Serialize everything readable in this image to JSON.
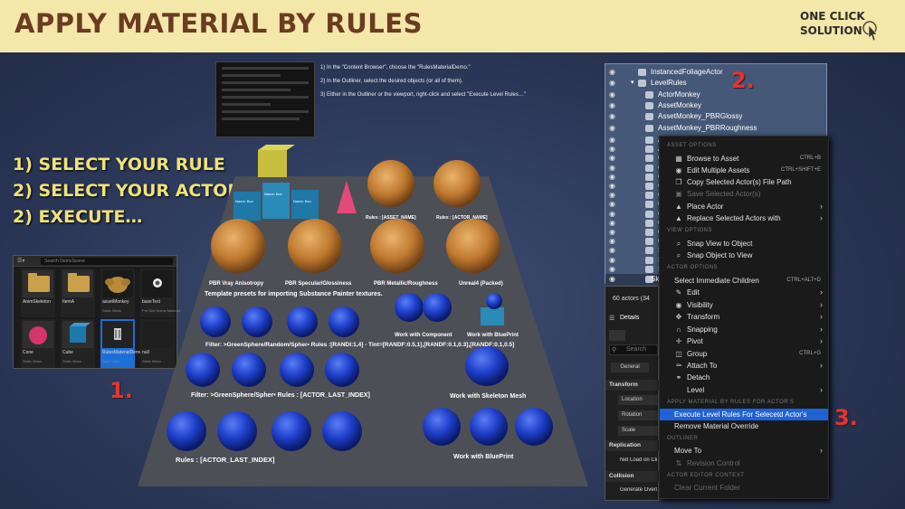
{
  "banner": {
    "title": "APPLY MATERIAL BY RULES",
    "one_click_line1": "ONE CLICK",
    "one_click_line2": "SOLUTION",
    "icon": "pointer-cursor-icon",
    "bg_color": "#f3e7a9",
    "title_color": "#6b3b23"
  },
  "steps": {
    "line1": "1) SELECT YOUR RULE",
    "line2": "2) SELECT YOUR ACTOR’S",
    "line3": "2) EXECUTE…",
    "color": "#f1e27a"
  },
  "markers": {
    "m1": "1.",
    "m2": "2.",
    "m3": "3.",
    "color": "#e8322f"
  },
  "instructions": [
    "1) In the \"Content Browser\", choose the \"RulesMaterialDemo.\"",
    "2) In the Outliner, select the desired objects (or all of them).",
    "3) Either in the Outliner or the viewport, right-click and select \"Execute Level Rules…\""
  ],
  "content_browser": {
    "search_placeholder": "Search DemoScene",
    "tiles": [
      {
        "name": "AnimSkeleton",
        "type": ""
      },
      {
        "name": "ItemA",
        "type": ""
      },
      {
        "name": "assetMonkey",
        "type": "Static Mesh"
      },
      {
        "name": "baseText",
        "type": "Pre Dist Scene Material"
      },
      {
        "name": "Cone",
        "type": "Static Mesh"
      },
      {
        "name": "Cube",
        "type": "Static Mesh"
      },
      {
        "name": "RulesMaterialDemo",
        "type": "Data Table"
      },
      {
        "name": "null",
        "type": "Static Mesh"
      }
    ]
  },
  "viewport": {
    "rules_asset_name": "Rules : [ASSET_NAME]",
    "rules_actor_name": "Rules : [ACTOR_NAME]",
    "pbr_labels": [
      "PBR Vray Anisotropy",
      "PBR Specular/Glossiness",
      "PBR Metallic/Roughness",
      "Unreal4 (Packed)"
    ],
    "template_text": "Template presets for importing Substance Painter textures.",
    "work_component": "Work with Component",
    "work_blueprint_top": "Work with BluePrint",
    "filter_random": "Filter: >GreenSphere/Random/Spher• Rules :[RANDI:1,4] - Tint=[RANDF:0.5,1],[RANDF:0.1,0.3],[RANDF:0.1,0.5]",
    "filter_last": "Filter: >GreenSphere/Spher• Rules : [ACTOR_LAST_INDEX]",
    "work_skeleton": "Work with Skeleton Mesh",
    "rules_last": "Rules : [ACTOR_LAST_INDEX]",
    "work_blueprint_bottom": "Work with BluePrint",
    "box_labels": [
      "Name: Box",
      "Name: Box",
      "Name: Box"
    ]
  },
  "outliner": {
    "rows": [
      {
        "label": "InstancedFoliageActor",
        "indent": 0
      },
      {
        "label": "LevelRules",
        "indent": 0
      },
      {
        "label": "ActorMonkey",
        "indent": 1
      },
      {
        "label": "AssetMonkey",
        "indent": 1
      },
      {
        "label": "AssetMonkey_PBRGlossy",
        "indent": 1
      },
      {
        "label": "AssetMonkey_PBRRoughness",
        "indent": 1
      }
    ],
    "partial_rows": [
      "A",
      "A",
      "C",
      "C",
      "C",
      "C",
      "C",
      "C",
      "C",
      "C",
      "G",
      "G",
      "S",
      "S",
      "S"
    ],
    "last_row": "Sk"
  },
  "side_panel": {
    "actor_count": "60 actors (34",
    "details_tab": "Details",
    "search_placeholder": "Search",
    "general_tab": "General",
    "transform_header": "Transform",
    "location": "Location",
    "rotation": "Rotation",
    "scale": "Scale",
    "replication_header": "Replication",
    "net_load": "Net Load on Cli",
    "collision_header": "Collision",
    "generate_overlap": "Generate Overl"
  },
  "context_menu": {
    "sections": {
      "asset": "ASSET OPTIONS",
      "view": "VIEW OPTIONS",
      "actor": "ACTOR OPTIONS",
      "apply": "APPLY MATERIAL BY RULES FOR ACTOR'S",
      "outliner": "OUTLINER",
      "editor": "ACTOR EDITOR CONTEXT"
    },
    "items": {
      "browse": {
        "label": "Browse to Asset",
        "shortcut": "CTRL+B"
      },
      "edit_multiple": {
        "label": "Edit Multiple Assets",
        "shortcut": "CTRL+SHIFT+E"
      },
      "copy_path": {
        "label": "Copy Selected Actor(s) File Path"
      },
      "save_selected": {
        "label": "Save Selected Actor(s)"
      },
      "place_actor": {
        "label": "Place Actor"
      },
      "replace": {
        "label": "Replace Selected Actors with"
      },
      "snap_view": {
        "label": "Snap View to Object"
      },
      "snap_object": {
        "label": "Snap Object to View"
      },
      "select_children": {
        "label": "Select Immediate Children",
        "shortcut": "CTRL+ALT+D"
      },
      "edit": {
        "label": "Edit"
      },
      "visibility": {
        "label": "Visibility"
      },
      "transform": {
        "label": "Transform"
      },
      "snapping": {
        "label": "Snapping"
      },
      "pivot": {
        "label": "Pivot"
      },
      "group": {
        "label": "Group",
        "shortcut": "CTRL+G"
      },
      "attach": {
        "label": "Attach To"
      },
      "detach": {
        "label": "Detach"
      },
      "level": {
        "label": "Level"
      },
      "execute": {
        "label": "Execute Level Rules For Selecetd Actor's"
      },
      "remove_override": {
        "label": "Remove Material Override"
      },
      "move_to": {
        "label": "Move To"
      },
      "revision": {
        "label": "Revision Control"
      },
      "clear_folder": {
        "label": "Clear Current Folder"
      }
    },
    "highlight_color": "#1e62d6"
  }
}
